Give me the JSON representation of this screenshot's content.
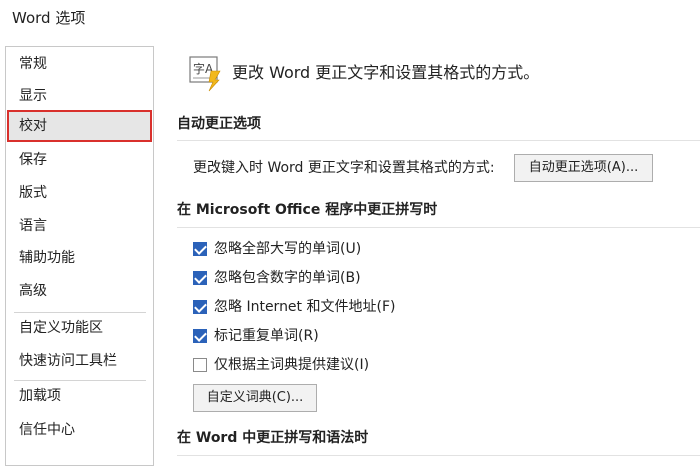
{
  "window": {
    "title": "Word 选项"
  },
  "sidebar": {
    "items": [
      {
        "label": "常规"
      },
      {
        "label": "显示"
      },
      {
        "label": "校对",
        "selected": true
      },
      {
        "label": "保存"
      },
      {
        "label": "版式"
      },
      {
        "label": "语言"
      },
      {
        "label": "辅助功能"
      },
      {
        "label": "高级"
      },
      {
        "label": "自定义功能区"
      },
      {
        "label": "快速访问工具栏"
      },
      {
        "label": "加载项"
      },
      {
        "label": "信任中心"
      }
    ]
  },
  "header": {
    "icon": "proofing-abc-icon",
    "icon_letters": "字A",
    "text": "更改 Word 更正文字和设置其格式的方式。"
  },
  "autocorrect": {
    "section_title": "自动更正选项",
    "description": "更改键入时 Word 更正文字和设置其格式的方式:",
    "button_label": "自动更正选项(A)..."
  },
  "office_spelling": {
    "section_title": "在 Microsoft Office 程序中更正拼写时",
    "options": [
      {
        "label": "忽略全部大写的单词(U)",
        "checked": true
      },
      {
        "label": "忽略包含数字的单词(B)",
        "checked": true
      },
      {
        "label": "忽略 Internet 和文件地址(F)",
        "checked": true
      },
      {
        "label": "标记重复单词(R)",
        "checked": true
      },
      {
        "label": "仅根据主词典提供建议(I)",
        "checked": false
      }
    ],
    "custom_dict_button": "自定义词典(C)..."
  },
  "word_spelling": {
    "section_title": "在 Word 中更正拼写和语法时"
  },
  "colors": {
    "selection_border": "#d9302c",
    "checkbox_checked": "#2b62b9"
  }
}
